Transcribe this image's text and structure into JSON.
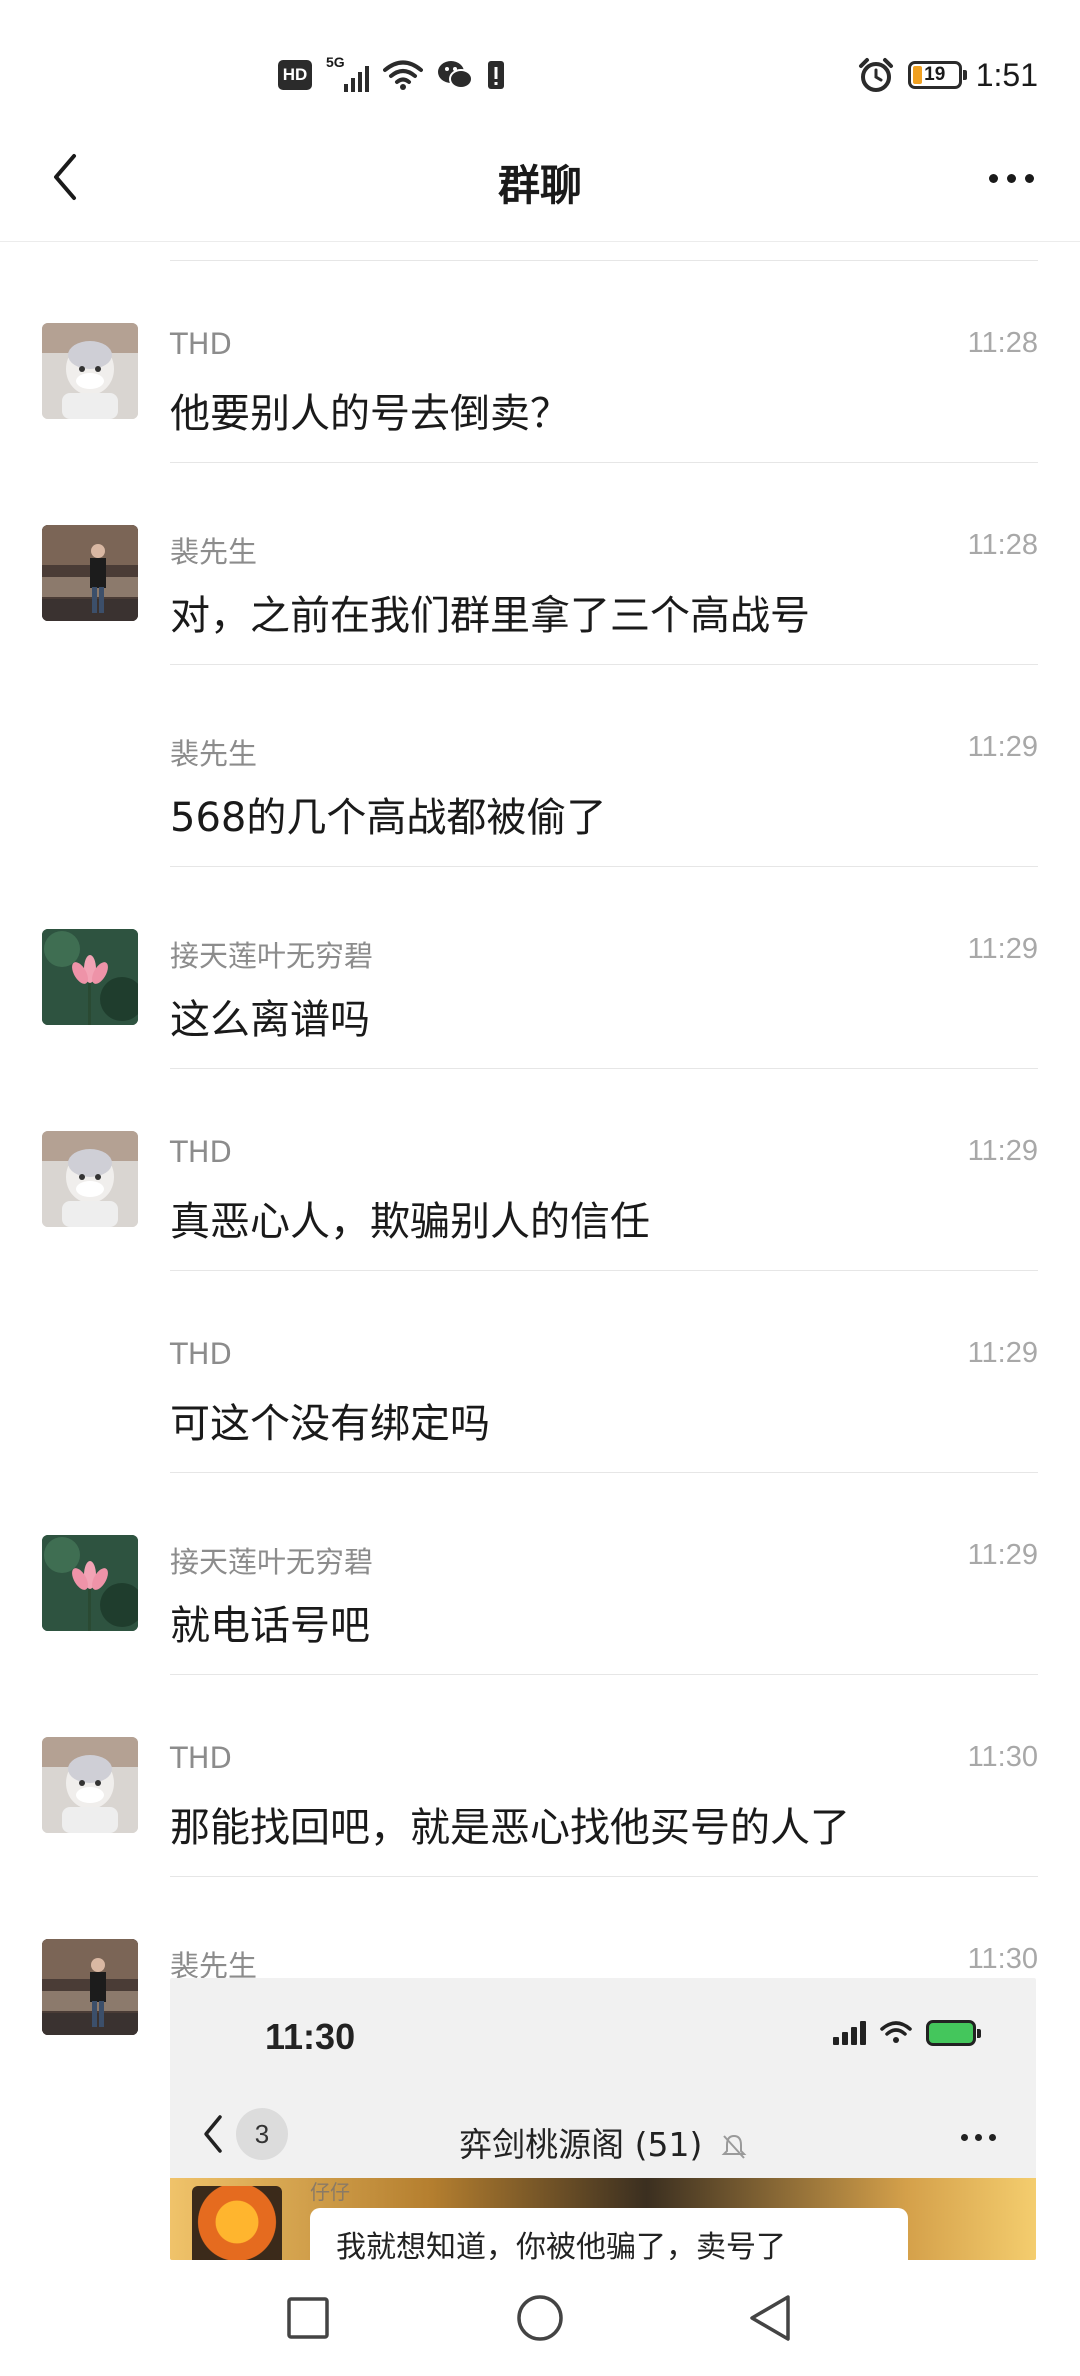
{
  "status_bar": {
    "hd_badge": "HD",
    "network_label": "5G",
    "battery_level": "19",
    "time": "1:51",
    "icons": [
      "hd-icon",
      "signal-5g-icon",
      "wifi-icon",
      "wechat-icon",
      "notification-icon",
      "alarm-icon",
      "battery-icon"
    ]
  },
  "header": {
    "title": "群聊",
    "back_icon": "chevron-left-icon",
    "more_icon": "more-horizontal-icon"
  },
  "messages": [
    {
      "sender": "THD",
      "time": "11:28",
      "text": "他要别人的号去倒卖？",
      "avatar": "thd-avatar"
    },
    {
      "sender": "裴先生",
      "time": "11:28",
      "text": "对，之前在我们群里拿了三个高战号",
      "avatar": "pei-avatar"
    },
    {
      "sender": "裴先生",
      "time": "11:29",
      "text": "568的几个高战都被偷了",
      "avatar": ""
    },
    {
      "sender": "接天莲叶无穷碧",
      "time": "11:29",
      "text": "这么离谱吗",
      "avatar": "lotus-avatar"
    },
    {
      "sender": "THD",
      "time": "11:29",
      "text": "真恶心人，欺骗别人的信任",
      "avatar": "thd-avatar"
    },
    {
      "sender": "THD",
      "time": "11:29",
      "text": "可这个没有绑定吗",
      "avatar": ""
    },
    {
      "sender": "接天莲叶无穷碧",
      "time": "11:29",
      "text": "就电话号吧",
      "avatar": "lotus-avatar"
    },
    {
      "sender": "THD",
      "time": "11:30",
      "text": "那能找回吧，就是恶心找他买号的人了",
      "avatar": "thd-avatar"
    },
    {
      "sender": "裴先生",
      "time": "11:30",
      "text": "",
      "avatar": "pei-avatar"
    }
  ],
  "image_message": {
    "status_time": "11:30",
    "back_count": "3",
    "chat_title": "弈剑桃源阁 (51)",
    "chat_name_partial": "仔仔",
    "bubble_text": "我就想知道，你被他骗了，卖号了"
  },
  "system_nav": {
    "recent_icon": "square-recent-apps-icon",
    "home_icon": "circle-home-icon",
    "back_icon": "triangle-back-icon"
  }
}
